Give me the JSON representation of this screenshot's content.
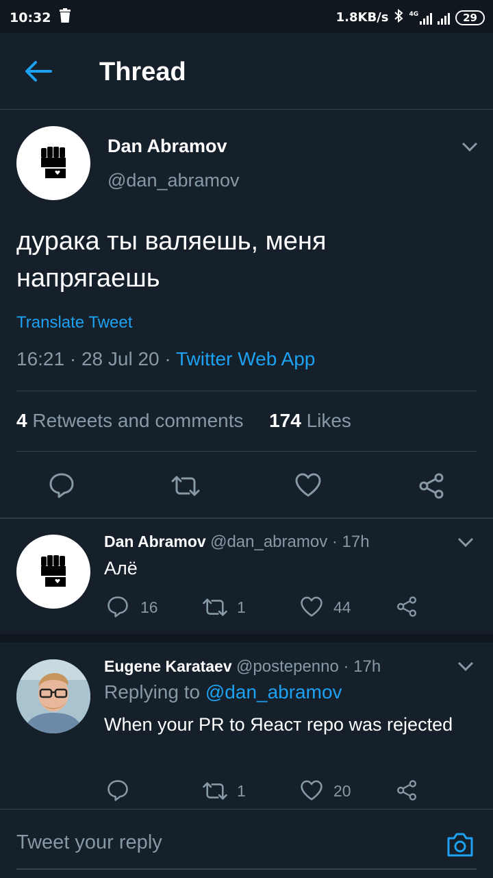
{
  "status": {
    "time": "10:32",
    "speed": "1.8KB/s",
    "network": "4G",
    "battery": "29"
  },
  "header": {
    "title": "Thread"
  },
  "tweet": {
    "author_name": "Dan Abramov",
    "author_handle": "@dan_abramov",
    "text_line1": "дурака ты валяешь, меня",
    "text_line2": "напрягаешь",
    "translate_label": "Translate Tweet",
    "time": "16:21",
    "date": "28 Jul 20",
    "source": "Twitter Web App",
    "retweets_count": "4",
    "retweets_label": "Retweets and comments",
    "likes_count": "174",
    "likes_label": "Likes"
  },
  "replies": [
    {
      "name": "Dan Abramov",
      "handle": "@dan_abramov",
      "time": "17h",
      "text": "Алё",
      "reply_count": "16",
      "retweet_count": "1",
      "like_count": "44"
    },
    {
      "name": "Eugene Karataev",
      "handle": "@postepenno",
      "time": "17h",
      "replying_prefix": "Replying to",
      "replying_to": "@dan_abramov",
      "text": "When your PR to Яеаст repo was rejected",
      "reply_count": "",
      "retweet_count": "1",
      "like_count": "20"
    }
  ],
  "composer": {
    "placeholder": "Tweet your reply"
  },
  "colors": {
    "background": "#15202b",
    "accent": "#1da1f2",
    "secondary_text": "#8899a6",
    "divider": "#38444d"
  }
}
